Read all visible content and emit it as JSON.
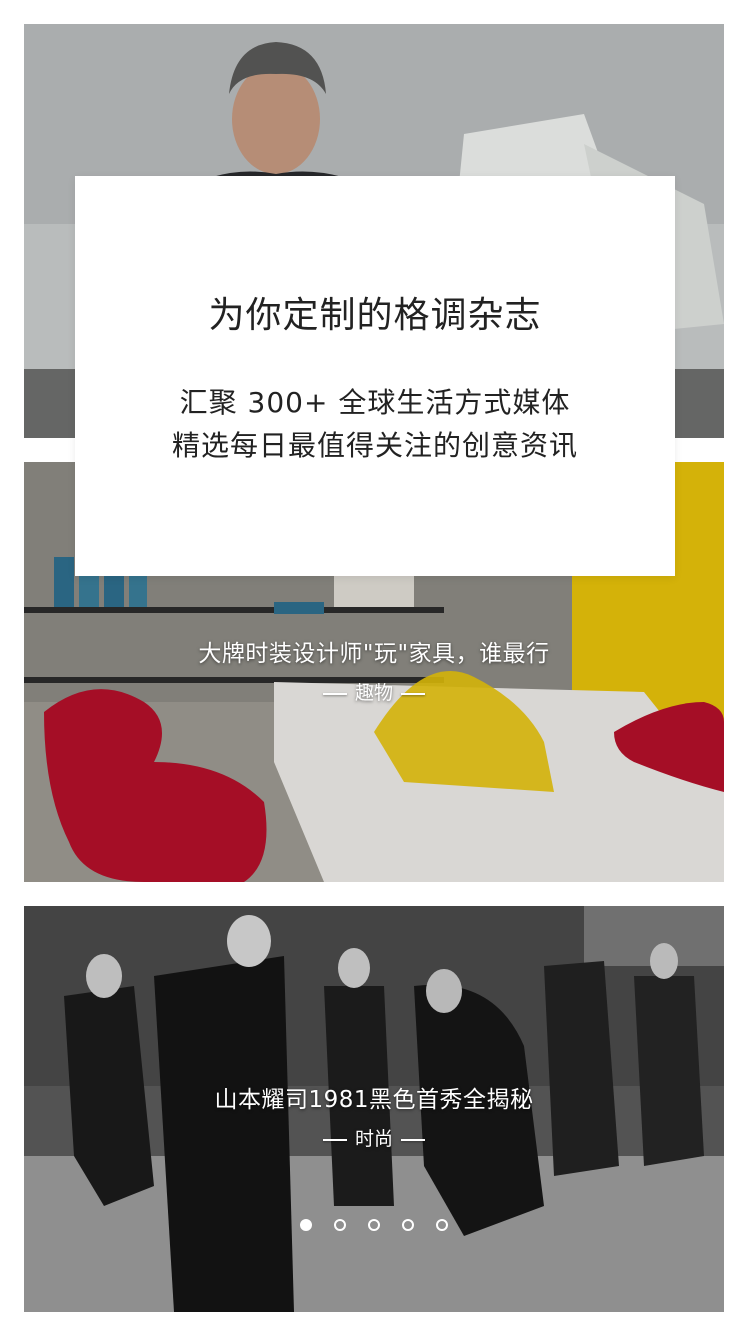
{
  "intro": {
    "title": "为你定制的格调杂志",
    "line1": "汇聚 300+ 全球生活方式媒体",
    "line2": "精选每日最值得关注的创意资讯"
  },
  "articles": [
    {
      "headline": "",
      "category": ""
    },
    {
      "headline": "大牌时装设计师\"玩\"家具，谁最行",
      "category": "趣物"
    },
    {
      "headline": "山本耀司1981黑色首秀全揭秘",
      "category": "时尚"
    }
  ],
  "pager": {
    "count": 5,
    "active_index": 0
  },
  "colors": {
    "red_chair": "#b3102a",
    "yellow_panel": "#e6c20a",
    "text_dark": "#222222"
  }
}
